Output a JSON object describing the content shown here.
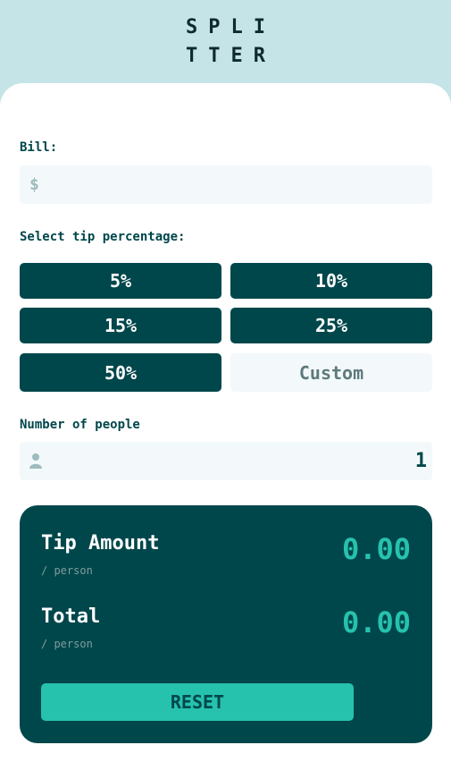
{
  "logo": {
    "line1": "SPLI",
    "line2": "TTER"
  },
  "bill": {
    "label": "Bill:",
    "currency_icon": "dollar-icon",
    "currency_symbol": "$",
    "value": ""
  },
  "tip": {
    "label": "Select tip percentage:",
    "options": [
      "5%",
      "10%",
      "15%",
      "25%",
      "50%"
    ],
    "custom_placeholder": "Custom"
  },
  "people": {
    "label": "Number of people",
    "icon": "person-icon",
    "value": "1"
  },
  "results": {
    "tip_amount_label": "Tip Amount",
    "tip_amount_sub": "/ person",
    "tip_amount_value": "0.00",
    "total_label": "Total",
    "total_sub": "/ person",
    "total_value": "0.00",
    "reset_label": "RESET"
  },
  "colors": {
    "primary": "#00474b",
    "accent": "#26c2ae",
    "background": "#c5e4e7",
    "input_bg": "#f3f9fa"
  }
}
